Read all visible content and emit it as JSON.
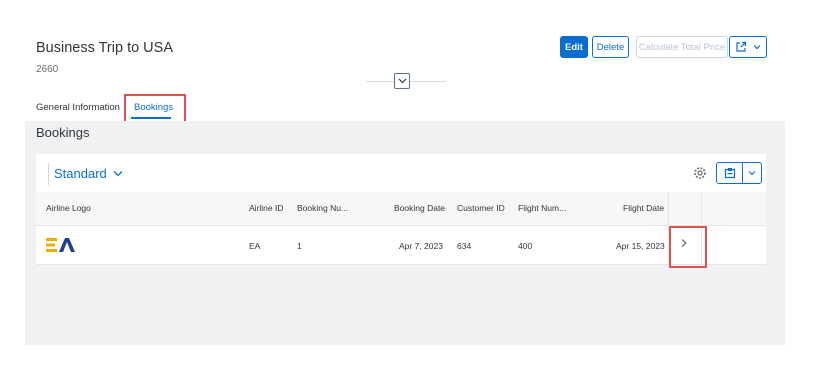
{
  "header": {
    "title": "Business Trip to USA",
    "subtitle": "2660",
    "actions": {
      "edit": "Edit",
      "delete": "Delete",
      "calculate": "Calculate Total Price"
    }
  },
  "tabs": [
    {
      "label": "General Information",
      "selected": false
    },
    {
      "label": "Bookings",
      "selected": true
    }
  ],
  "section": {
    "title": "Bookings",
    "variant": "Standard"
  },
  "table": {
    "columns": [
      "Airline Logo",
      "Airline ID",
      "Booking Nu...",
      "Booking Date",
      "Customer ID",
      "Flight Num...",
      "Flight Date"
    ],
    "rows": [
      {
        "airline_logo": "EA",
        "airline_id": "EA",
        "booking_number": "1",
        "booking_date": "Apr 7, 2023",
        "customer_id": "634",
        "flight_number": "400",
        "flight_date": "Apr 15, 2023"
      }
    ]
  },
  "icons": {
    "share": "share-icon",
    "collapse": "chevron-down-icon",
    "settings": "gear-icon",
    "export": "export-icon",
    "navigation": "chevron-right-icon"
  },
  "colors": {
    "accent": "#0a6ed1",
    "highlight": "#d9534f",
    "logo_yellow": "#f0ab00",
    "logo_blue": "#1f3f8f"
  }
}
